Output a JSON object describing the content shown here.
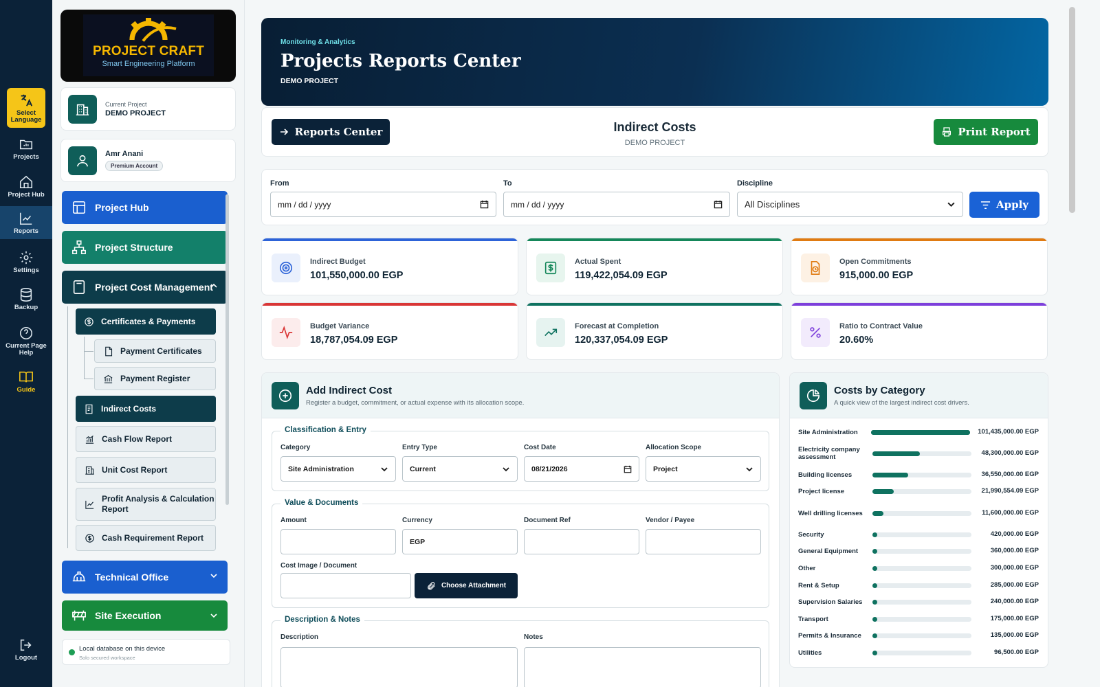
{
  "rail": {
    "language": "Select Language",
    "projects": "Projects",
    "project_hub": "Project Hub",
    "reports": "Reports",
    "settings": "Settings",
    "backup": "Backup",
    "help": "Current Page Help",
    "guide": "Guide",
    "logout": "Logout"
  },
  "brand": {
    "title": "PROJECT CRAFT",
    "subtitle": "Smart Engineering Platform"
  },
  "project_card": {
    "label": "Current Project",
    "value": "DEMO PROJECT"
  },
  "user_card": {
    "name": "Amr Anani",
    "badge": "Premium Account"
  },
  "sidebar": {
    "project_hub": "Project Hub",
    "project_structure": "Project Structure",
    "cost_management": "Project Cost Management",
    "certificates_payments": "Certificates & Payments",
    "payment_certificates": "Payment Certificates",
    "payment_register": "Payment Register",
    "indirect_costs": "Indirect Costs",
    "cash_flow_report": "Cash Flow Report",
    "unit_cost_report": "Unit Cost Report",
    "profit_analysis": "Profit Analysis & Calculation Report",
    "cash_requirement": "Cash Requirement Report",
    "technical_office": "Technical Office",
    "site_execution": "Site Execution"
  },
  "db_status": {
    "title": "Local database on this device",
    "subtitle": "Solo secured workspace"
  },
  "hero": {
    "kicker": "Monitoring & Analytics",
    "title": "Projects Reports Center",
    "subtitle": "DEMO PROJECT"
  },
  "toolbar": {
    "reports_center": "Reports Center",
    "title": "Indirect Costs",
    "subtitle": "DEMO PROJECT",
    "print": "Print Report"
  },
  "filters": {
    "from_label": "From",
    "from_value": "mm / dd / yyyy",
    "to_label": "To",
    "to_value": "mm / dd / yyyy",
    "discipline_label": "Discipline",
    "discipline_value": "All Disciplines",
    "apply": "Apply"
  },
  "kpis": [
    {
      "label": "Indirect Budget",
      "value": "101,550,000.00 EGP",
      "color": "#2d63d8"
    },
    {
      "label": "Actual Spent",
      "value": "119,422,054.09 EGP",
      "color": "#15875a"
    },
    {
      "label": "Open Commitments",
      "value": "915,000.00 EGP",
      "color": "#e07b12"
    },
    {
      "label": "Budget Variance",
      "value": "18,787,054.09 EGP",
      "color": "#d93636"
    },
    {
      "label": "Forecast at Completion",
      "value": "120,337,054.09 EGP",
      "color": "#0f7260"
    },
    {
      "label": "Ratio to Contract Value",
      "value": "20.60%",
      "color": "#7d3fdb"
    }
  ],
  "form": {
    "title": "Add Indirect Cost",
    "subtitle": "Register a budget, commitment, or actual expense with its allocation scope.",
    "section1": "Classification & Entry",
    "category_label": "Category",
    "category_value": "Site Administration",
    "entry_type_label": "Entry Type",
    "entry_type_value": "Current",
    "cost_date_label": "Cost Date",
    "cost_date_value": "08/21/2026",
    "scope_label": "Allocation Scope",
    "scope_value": "Project",
    "section2": "Value & Documents",
    "amount_label": "Amount",
    "amount_value": "",
    "currency_label": "Currency",
    "currency_value": "EGP",
    "docref_label": "Document Ref",
    "docref_value": "",
    "vendor_label": "Vendor / Payee",
    "vendor_value": "",
    "image_label": "Cost Image / Document",
    "attach": "Choose Attachment",
    "section3": "Description & Notes",
    "description_label": "Description",
    "notes_label": "Notes"
  },
  "categories": {
    "title": "Costs by Category",
    "subtitle": "A quick view of the largest indirect cost drivers.",
    "items": [
      {
        "name": "Site Administration",
        "value": "101,435,000.00 EGP",
        "amount": 101435000
      },
      {
        "name": "Electricity company assessment",
        "value": "48,300,000.00 EGP",
        "amount": 48300000
      },
      {
        "name": "Building licenses",
        "value": "36,550,000.00 EGP",
        "amount": 36550000
      },
      {
        "name": "Project license",
        "value": "21,990,554.09 EGP",
        "amount": 21990554.09
      },
      {
        "name": "Well drilling licenses",
        "value": "11,600,000.00 EGP",
        "amount": 11600000
      },
      {
        "name": "Security",
        "value": "420,000.00 EGP",
        "amount": 420000
      },
      {
        "name": "General Equipment",
        "value": "360,000.00 EGP",
        "amount": 360000
      },
      {
        "name": "Other",
        "value": "300,000.00 EGP",
        "amount": 300000
      },
      {
        "name": "Rent & Setup",
        "value": "285,000.00 EGP",
        "amount": 285000
      },
      {
        "name": "Supervision Salaries",
        "value": "240,000.00 EGP",
        "amount": 240000
      },
      {
        "name": "Transport",
        "value": "175,000.00 EGP",
        "amount": 175000
      },
      {
        "name": "Permits & Insurance",
        "value": "135,000.00 EGP",
        "amount": 135000
      },
      {
        "name": "Utilities",
        "value": "96,500.00 EGP",
        "amount": 96500
      }
    ]
  }
}
